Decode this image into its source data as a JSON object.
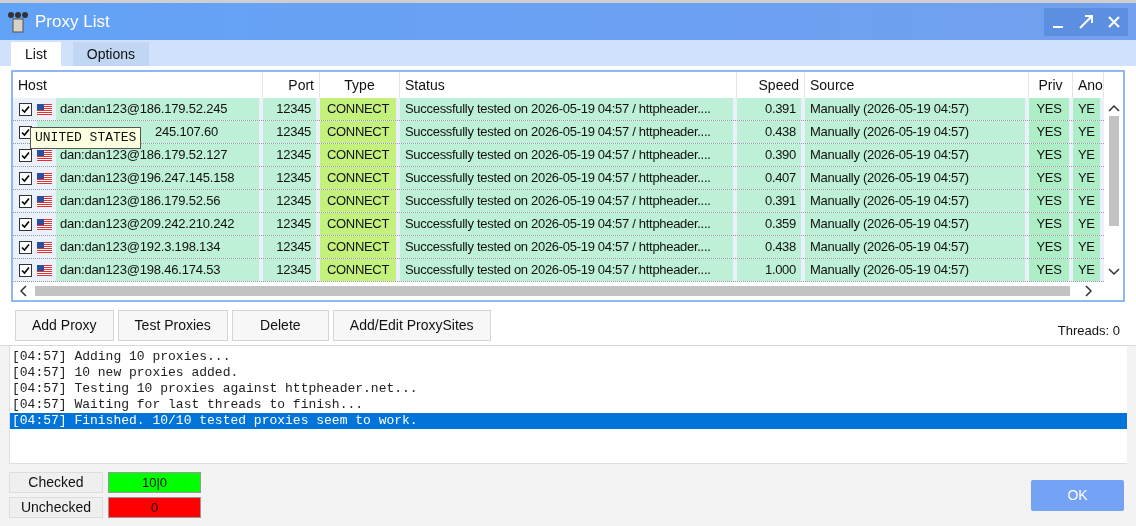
{
  "window": {
    "title": "Proxy List"
  },
  "tabs": [
    {
      "label": "List",
      "selected": true
    },
    {
      "label": "Options",
      "selected": false
    }
  ],
  "table": {
    "columns": [
      "Host",
      "Port",
      "Type",
      "Status",
      "Speed",
      "Source",
      "Priv",
      "Ano"
    ],
    "rows": [
      {
        "checked": true,
        "host": "dan:dan123@186.179.52.245",
        "port": "12345",
        "type": "CONNECT",
        "status": "Successfully tested on 2026-05-19 04:57 / httpheader....",
        "speed": "0.391",
        "source": "Manually (2026-05-19 04:57)",
        "priv": "YES",
        "ano": "YE"
      },
      {
        "checked": true,
        "covered": true,
        "host": "245.107.60",
        "port": "12345",
        "type": "CONNECT",
        "status": "Successfully tested on 2026-05-19 04:57 / httpheader....",
        "speed": "0.438",
        "source": "Manually (2026-05-19 04:57)",
        "priv": "YES",
        "ano": "YE"
      },
      {
        "checked": true,
        "host": "dan:dan123@186.179.52.127",
        "port": "12345",
        "type": "CONNECT",
        "status": "Successfully tested on 2026-05-19 04:57 / httpheader....",
        "speed": "0.390",
        "source": "Manually (2026-05-19 04:57)",
        "priv": "YES",
        "ano": "YE"
      },
      {
        "checked": true,
        "host": "dan:dan123@196.247.145.158",
        "port": "12345",
        "type": "CONNECT",
        "status": "Successfully tested on 2026-05-19 04:57 / httpheader....",
        "speed": "0.407",
        "source": "Manually (2026-05-19 04:57)",
        "priv": "YES",
        "ano": "YE"
      },
      {
        "checked": true,
        "host": "dan:dan123@186.179.52.56",
        "port": "12345",
        "type": "CONNECT",
        "status": "Successfully tested on 2026-05-19 04:57 / httpheader....",
        "speed": "0.391",
        "source": "Manually (2026-05-19 04:57)",
        "priv": "YES",
        "ano": "YE"
      },
      {
        "checked": true,
        "host": "dan:dan123@209.242.210.242",
        "port": "12345",
        "type": "CONNECT",
        "status": "Successfully tested on 2026-05-19 04:57 / httpheader....",
        "speed": "0.359",
        "source": "Manually (2026-05-19 04:57)",
        "priv": "YES",
        "ano": "YE"
      },
      {
        "checked": true,
        "host": "dan:dan123@192.3.198.134",
        "port": "12345",
        "type": "CONNECT",
        "status": "Successfully tested on 2026-05-19 04:57 / httpheader....",
        "speed": "0.438",
        "source": "Manually (2026-05-19 04:57)",
        "priv": "YES",
        "ano": "YE"
      },
      {
        "checked": true,
        "host": "dan:dan123@198.46.174.53",
        "port": "12345",
        "type": "CONNECT",
        "status": "Successfully tested on 2026-05-19 04:57 / httpheader....",
        "speed": "1.000",
        "source": "Manually (2026-05-19 04:57)",
        "priv": "YES",
        "ano": "YE"
      }
    ]
  },
  "tooltip": "UNITED STATES",
  "buttons": [
    "Add Proxy",
    "Test Proxies",
    "Delete",
    "Add/Edit ProxySites"
  ],
  "threads": "Threads: 0",
  "log": [
    {
      "text": "[04:57] Adding 10 proxies...",
      "selected": false
    },
    {
      "text": "[04:57] 10 new proxies added.",
      "selected": false
    },
    {
      "text": "[04:57] Testing 10 proxies against httpheader.net...",
      "selected": false
    },
    {
      "text": "[04:57] Waiting for last threads to finish...",
      "selected": false
    },
    {
      "text": "[04:57] Finished. 10/10 tested proxies seem to work.",
      "selected": true
    }
  ],
  "counters": [
    {
      "label": "Checked",
      "value": "10|0",
      "color": "#00ff00"
    },
    {
      "label": "Unchecked",
      "value": "0",
      "color": "#ff0000"
    }
  ],
  "ok_button": "OK"
}
